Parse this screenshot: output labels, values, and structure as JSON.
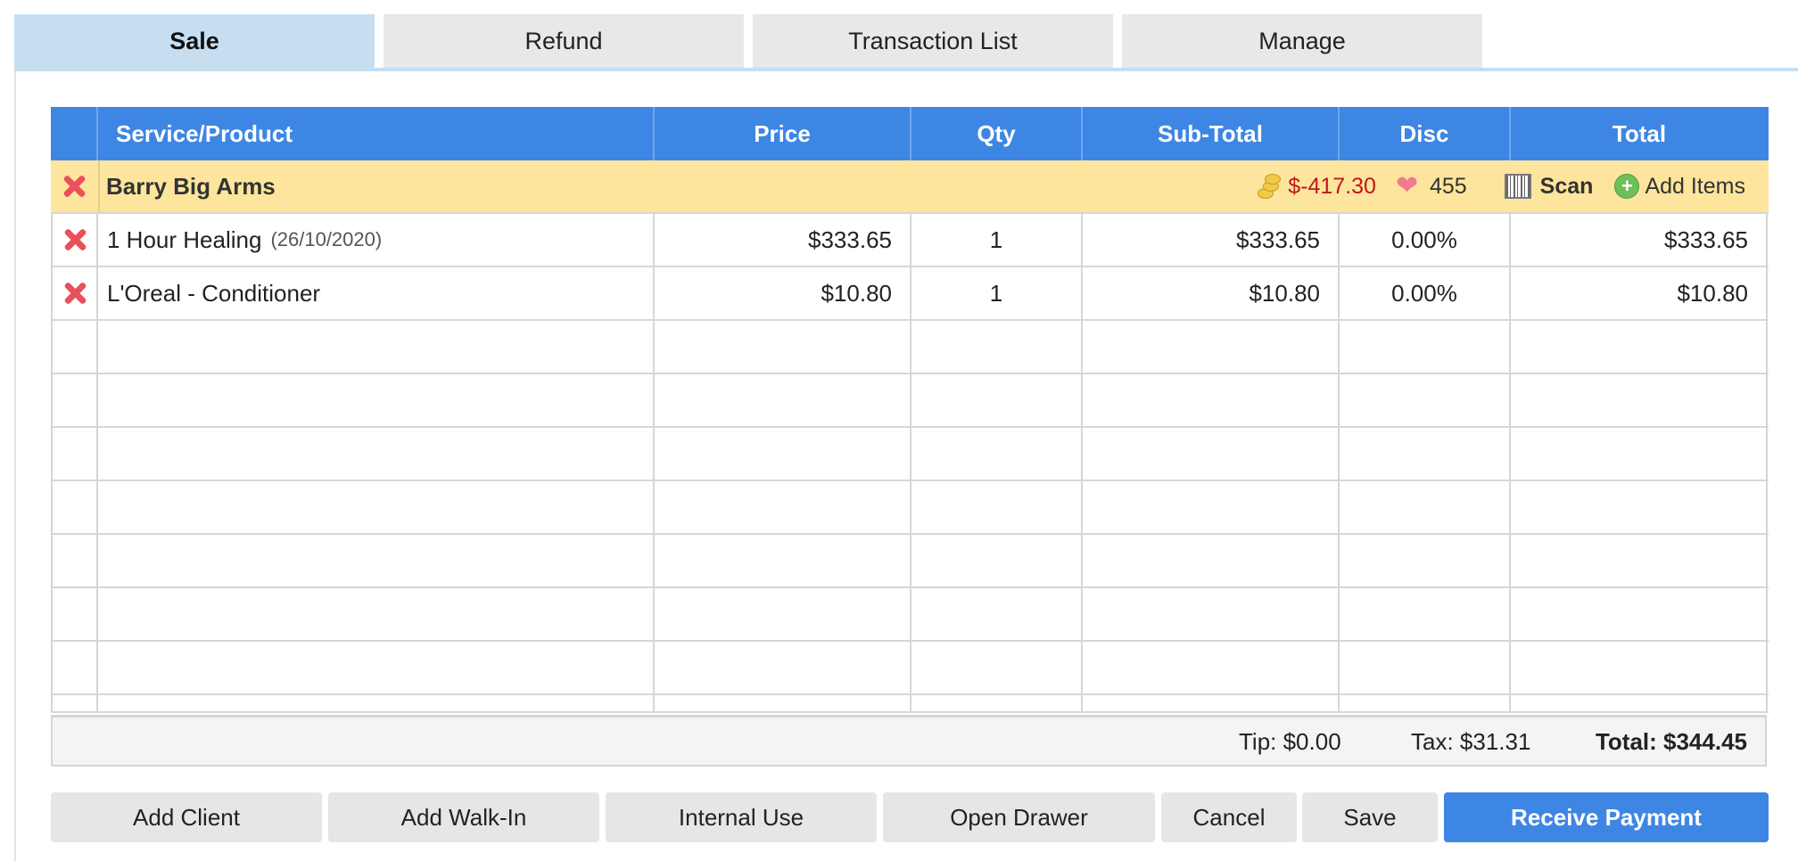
{
  "tabs": [
    {
      "label": "Sale"
    },
    {
      "label": "Refund"
    },
    {
      "label": "Transaction List"
    },
    {
      "label": "Manage"
    }
  ],
  "table": {
    "headers": [
      "",
      "Service/Product",
      "Price",
      "Qty",
      "Sub-Total",
      "Disc",
      "Total"
    ],
    "client": {
      "name": "Barry Big Arms",
      "balance": "$-417.30",
      "points": "455",
      "scan_label": "Scan",
      "add_items_label": "Add Items"
    },
    "items": [
      {
        "name": "1 Hour Healing",
        "date": "(26/10/2020)",
        "price": "$333.65",
        "qty": "1",
        "subtotal": "$333.65",
        "disc": "0.00%",
        "total": "$333.65"
      },
      {
        "name": "L'Oreal - Conditioner",
        "date": "",
        "price": "$10.80",
        "qty": "1",
        "subtotal": "$10.80",
        "disc": "0.00%",
        "total": "$10.80"
      }
    ]
  },
  "totals": {
    "tip": "Tip: $0.00",
    "tax": "Tax: $31.31",
    "total": "Total: $344.45"
  },
  "buttons": {
    "add_client": "Add Client",
    "add_walkin": "Add Walk-In",
    "internal_use": "Internal Use",
    "open_drawer": "Open Drawer",
    "cancel": "Cancel",
    "save": "Save",
    "receive_payment": "Receive Payment"
  },
  "colors": {
    "header_blue": "#3e86e3",
    "active_tab": "#c6def0",
    "client_row": "#fde59d",
    "balance_red": "#c0161e"
  }
}
